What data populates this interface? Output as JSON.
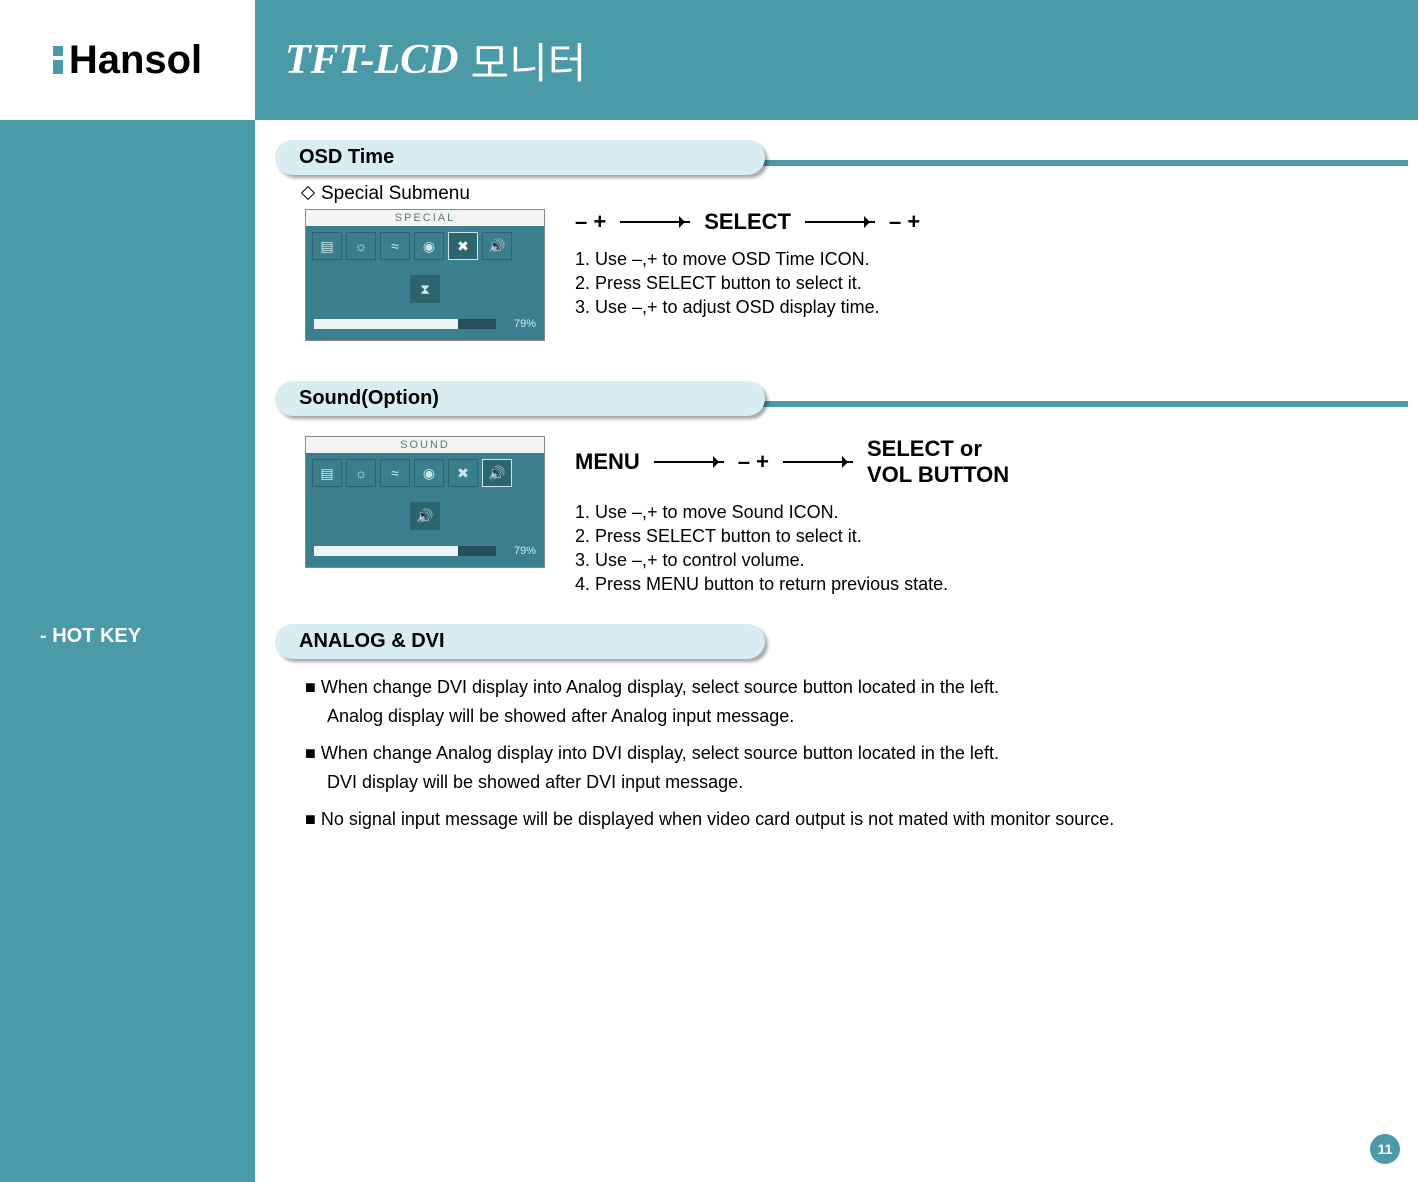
{
  "logo": {
    "text": "Hansol"
  },
  "header": {
    "title": "TFT-LCD",
    "subtitle": "모니터"
  },
  "sidebar": {
    "label": "- HOT KEY"
  },
  "sections": {
    "osd": {
      "title": "OSD Time",
      "subtitle": "Special  Submenu",
      "panel": {
        "title": "SPECIAL",
        "percent": "79%"
      },
      "flow": {
        "a": "–  +",
        "b": "SELECT",
        "c": "–  +"
      },
      "steps": [
        "1. Use –,+ to  move OSD Time ICON.",
        "2. Press SELECT button to select it.",
        "3. Use –,+ to adjust OSD display time."
      ]
    },
    "sound": {
      "title": "Sound(Option)",
      "panel": {
        "title": "SOUND",
        "percent": "79%"
      },
      "flow": {
        "a": "MENU",
        "b": "–  +",
        "c": "SELECT  or\nVOL BUTTON"
      },
      "steps": [
        "1. Use –,+ to  move Sound ICON.",
        "2. Press SELECT button to select it.",
        "3. Use –,+ to control volume.",
        "4. Press MENU button to return previous state."
      ]
    },
    "analog": {
      "title": "ANALOG & DVI",
      "notes": [
        "■ When change DVI display into Analog display, select source button located in the left.",
        "Analog display will be showed after Analog input message.",
        "■ When change Analog display into DVI display, select source button located in the left.",
        "DVI display will be showed after DVI input message.",
        "■ No signal input message will be displayed when video card output is not mated with monitor source."
      ]
    }
  },
  "page": "11"
}
